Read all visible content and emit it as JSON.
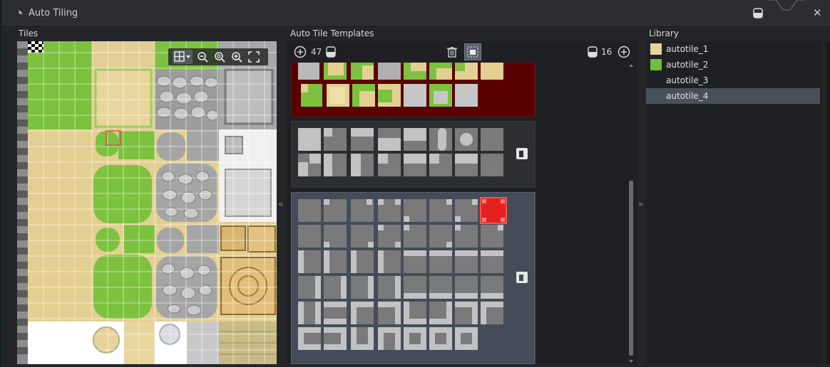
{
  "window": {
    "title": "Auto Tiling",
    "close_glyph": "✕"
  },
  "sections": {
    "tiles": "Tiles",
    "templates": "Auto Tile Templates",
    "library": "Library"
  },
  "tiles_toolbar": {
    "icons": [
      "grid-dropdown-icon",
      "zoom-out-icon",
      "zoom-reset-icon",
      "zoom-in-icon",
      "fit-screen-icon"
    ]
  },
  "templates_toolbar": {
    "add_left_glyph": "+",
    "count_left": "47",
    "count_right": "16",
    "add_right_glyph": "+"
  },
  "collapse": {
    "left_glyph": "«",
    "right_glyph": "»"
  },
  "library": {
    "items": [
      {
        "label": "autotile_1",
        "swatch": "#e6d49a"
      },
      {
        "label": "autotile_2",
        "swatch": "#6fbf3a"
      },
      {
        "label": "autotile_3",
        "swatch": ""
      },
      {
        "label": "autotile_4",
        "swatch": ""
      }
    ],
    "selected_index": 3
  },
  "colors": {
    "selected_template_bg": "#454c59",
    "first_template_bg": "#5a0000",
    "tile_light": "#c2c2c2",
    "tile_dark": "#7a7a7a",
    "highlight_red": "#e52020"
  }
}
